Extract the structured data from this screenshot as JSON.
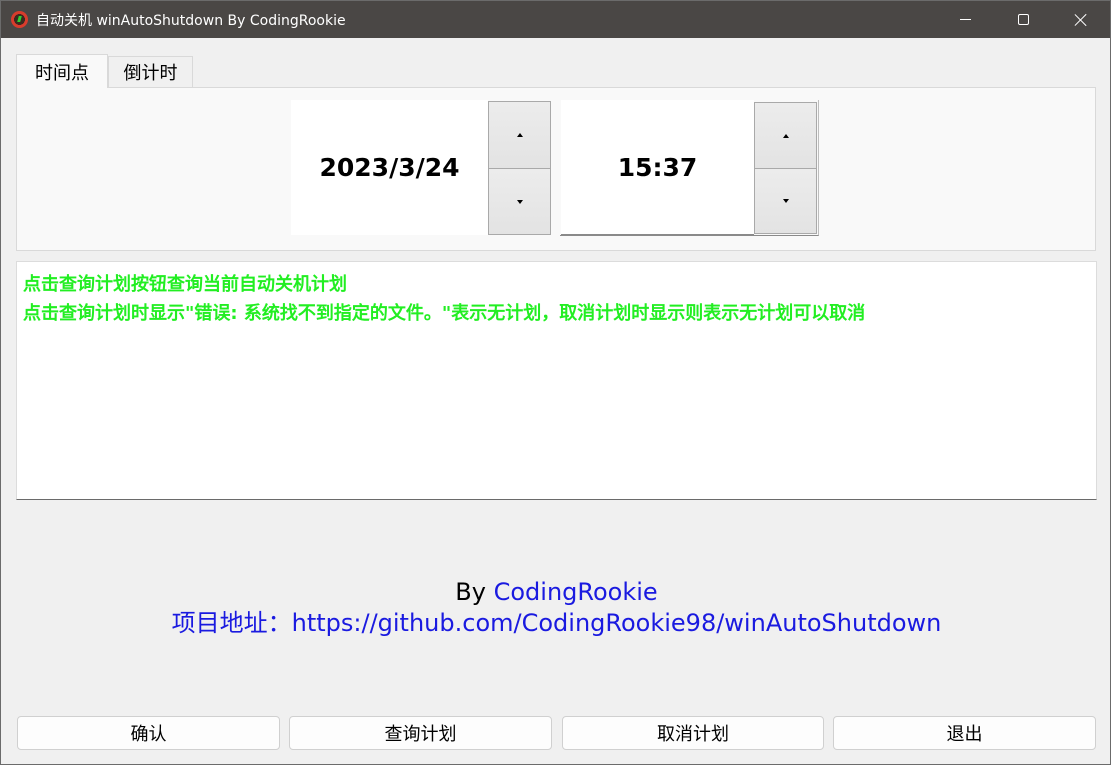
{
  "window": {
    "title": "自动关机 winAutoShutdown By CodingRookie",
    "app_icon": "app-icon",
    "controls": {
      "minimize": "minimize-icon",
      "maximize": "maximize-icon",
      "close": "close-icon"
    }
  },
  "tabs": [
    {
      "label": "时间点",
      "active": true
    },
    {
      "label": "倒计时",
      "active": false
    }
  ],
  "datetime": {
    "date": "2023/3/24",
    "time": "15:37"
  },
  "output": {
    "lines": [
      "点击查询计划按钮查询当前自动关机计划",
      "点击查询计划时显示\"错误: 系统找不到指定的文件。\"表示无计划，取消计划时显示则表示无计划可以取消"
    ],
    "text_color": "#22ee22"
  },
  "credits": {
    "by_prefix": "By",
    "author": "CodingRookie",
    "project_label": "项目地址：",
    "project_url": "https://github.com/CodingRookie98/winAutoShutdown",
    "link_color": "#1a1ae0"
  },
  "buttons": {
    "confirm": "确认",
    "query": "查询计划",
    "cancel": "取消计划",
    "exit": "退出"
  },
  "colors": {
    "titlebar": "#4a4745",
    "background": "#f0f0f0"
  }
}
